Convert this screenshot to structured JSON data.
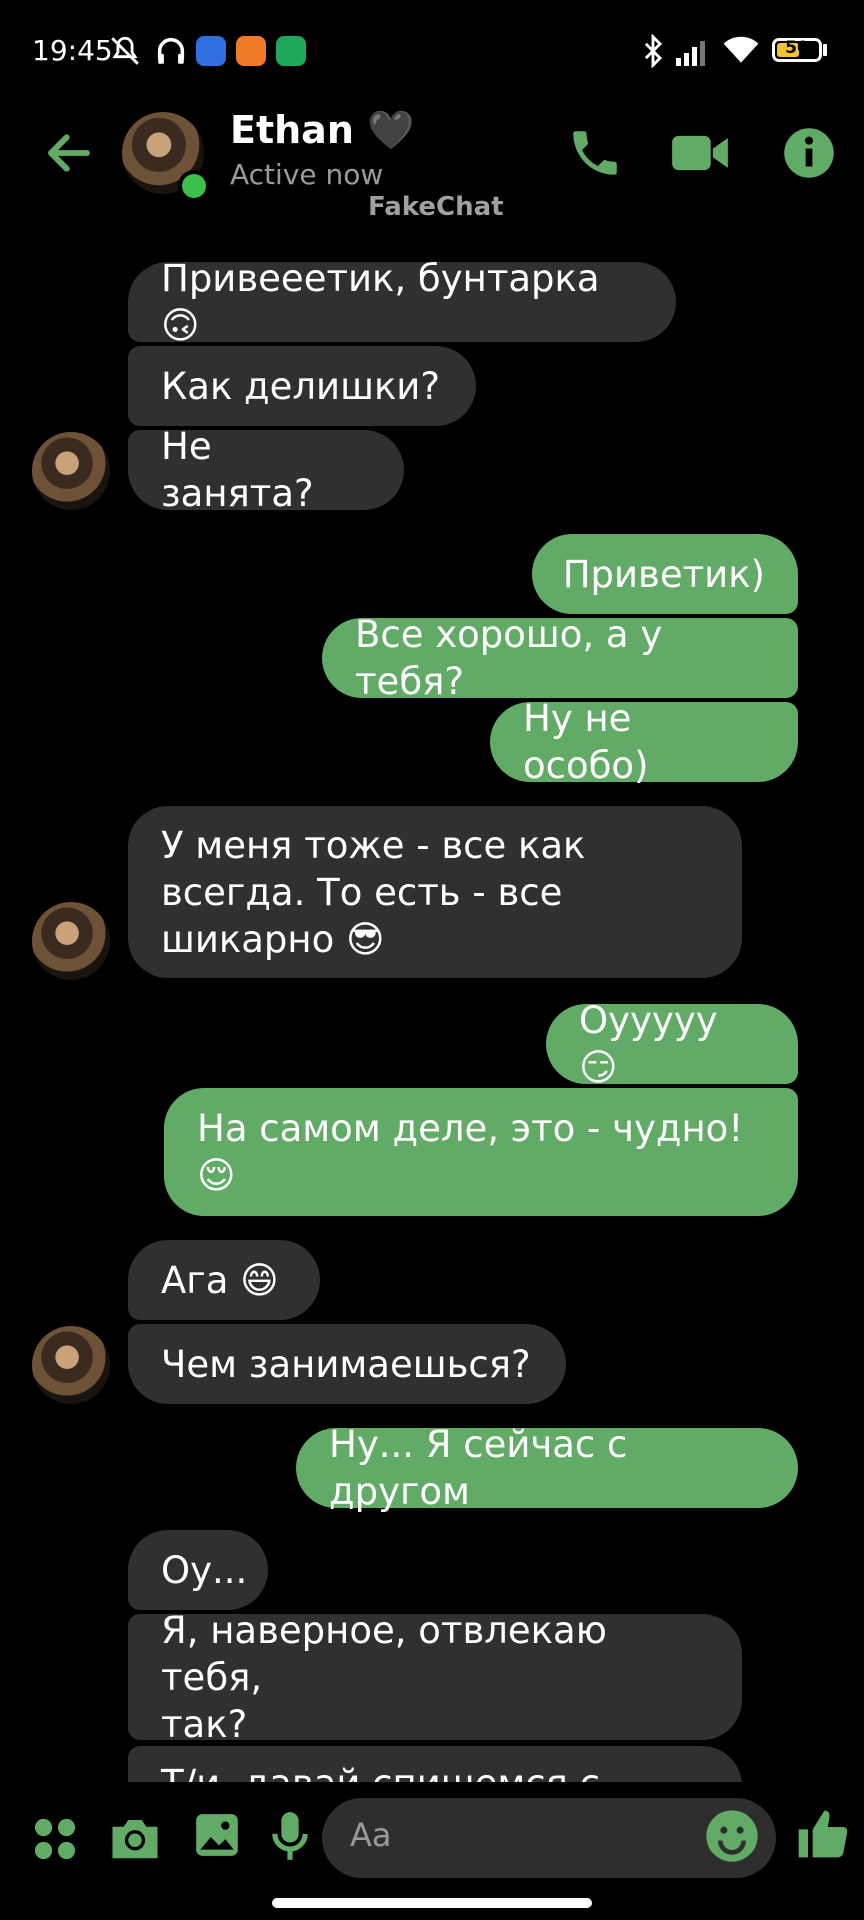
{
  "status_bar": {
    "time": "19:45",
    "battery": "50"
  },
  "header": {
    "name": "Ethan 🖤",
    "status": "Active now",
    "watermark": "FakeChat"
  },
  "messages": [
    {
      "from": "them",
      "text": "Привееетик, бунтарка 🙃"
    },
    {
      "from": "them",
      "text": "Как делишки?"
    },
    {
      "from": "them",
      "text": "Не занята?"
    },
    {
      "from": "me",
      "text": "Приветик)"
    },
    {
      "from": "me",
      "text": "Все хорошо, а у тебя?"
    },
    {
      "from": "me",
      "text": "Ну не особо)"
    },
    {
      "from": "them",
      "text": "У меня тоже - все как\nвсегда. То есть - все\nшикарно 😎"
    },
    {
      "from": "me",
      "text": "Оууууу 😏"
    },
    {
      "from": "me",
      "text": "На самом деле, это - чудно!\n😌"
    },
    {
      "from": "them",
      "text": "Ага 😄"
    },
    {
      "from": "them",
      "text": "Чем занимаешься?"
    },
    {
      "from": "me",
      "text": "Ну... Я сейчас с другом"
    },
    {
      "from": "them",
      "text": "Оу..."
    },
    {
      "from": "them",
      "text": "Я, наверное, отвлекаю тебя,\nтак?"
    },
    {
      "from": "them",
      "text": "Т/и, давай спишемся с..."
    }
  ],
  "composer": {
    "placeholder": "Aa"
  },
  "colors": {
    "accent": "#62ab66",
    "incoming": "#303030",
    "background": "#000000"
  },
  "icons": [
    "back-arrow-icon",
    "phone-icon",
    "video-icon",
    "info-icon",
    "apps-icon",
    "camera-icon",
    "gallery-icon",
    "mic-icon",
    "emoji-icon",
    "like-icon"
  ]
}
